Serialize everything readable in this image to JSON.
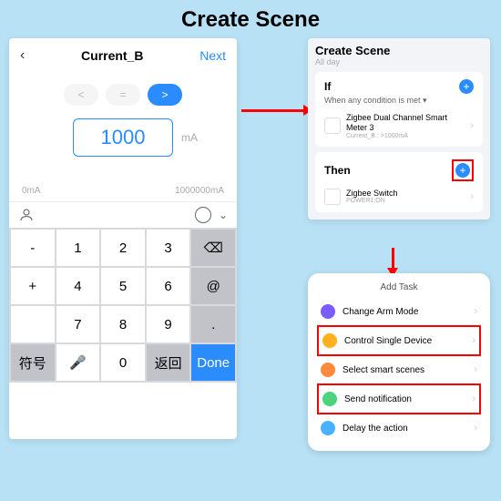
{
  "page_title": "Create Scene",
  "left_panel": {
    "back": "‹",
    "title": "Current_B",
    "next": "Next",
    "comparators": {
      "lt": "<",
      "eq": "=",
      "gt": ">"
    },
    "value": "1000",
    "unit": "mA",
    "range_min": "0mA",
    "range_max": "1000000mA",
    "keyboard": {
      "r1": [
        "-",
        "1",
        "2",
        "3",
        "⌫"
      ],
      "r2": [
        "+",
        "4",
        "5",
        "6",
        "@"
      ],
      "r3": [
        " ",
        "7",
        "8",
        "9",
        "."
      ],
      "r4": [
        "符号",
        "🎤",
        "0",
        "返回",
        "Done"
      ]
    }
  },
  "top_right": {
    "title": "Create Scene",
    "subtitle": "All day",
    "if": {
      "label": "If",
      "condition": "When any condition is met ▾",
      "device_name": "Zigbee Dual Channel Smart Meter 3",
      "device_sub": "Current_B : >1000mA"
    },
    "then": {
      "label": "Then",
      "device_name": "Zigbee Switch",
      "device_sub": "POWER1:ON"
    }
  },
  "bottom_right": {
    "title": "Add Task",
    "items": [
      "Change Arm Mode",
      "Control Single Device",
      "Select smart scenes",
      "Send notification",
      "Delay the action"
    ]
  }
}
